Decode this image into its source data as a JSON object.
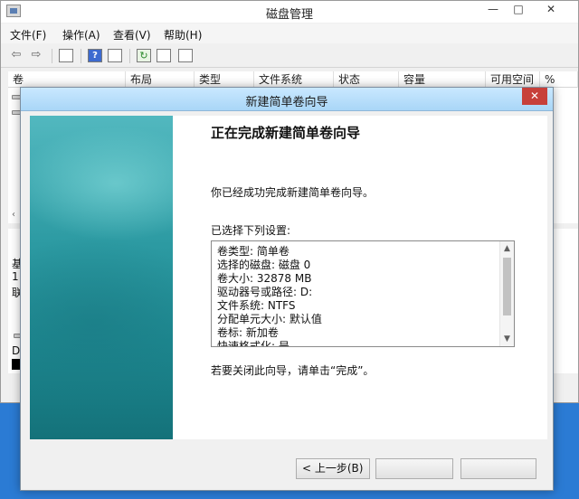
{
  "window": {
    "title": "磁盘管理",
    "min_glyph": "—",
    "max_glyph": "□",
    "close_glyph": "✕"
  },
  "menu": {
    "items": [
      "文件(F)",
      "操作(A)",
      "查看(V)",
      "帮助(H)"
    ]
  },
  "toolbar": {
    "back_glyph": "⇦",
    "forward_glyph": "⇨",
    "help_glyph": "?",
    "refresh_glyph": "↻"
  },
  "table": {
    "columns": [
      "卷",
      "布局",
      "类型",
      "文件系统",
      "状态",
      "容量",
      "可用空间",
      "%"
    ]
  },
  "lower": {
    "fragments": [
      "基",
      "1",
      "联",
      "D"
    ],
    "scroll_left_glyph": "‹"
  },
  "wizard": {
    "title": "新建简单卷向导",
    "close_glyph": "✕",
    "heading": "正在完成新建简单卷向导",
    "completed_text": "你已经成功完成新建简单卷向导。",
    "selected_label": "已选择下列设置:",
    "settings": [
      "卷类型: 简单卷",
      "选择的磁盘: 磁盘 0",
      "卷大小: 32878 MB",
      "驱动器号或路径: D:",
      "文件系统: NTFS",
      "分配单元大小: 默认值",
      "卷标: 新加卷",
      "快速格式化: 是"
    ],
    "scroll_up_glyph": "▲",
    "scroll_down_glyph": "▼",
    "close_instruction": "若要关闭此向导，请单击“完成”。",
    "buttons": {
      "back": "< 上一步(B)",
      "finish": "",
      "cancel": ""
    }
  },
  "colors": {
    "desktop": "#2b7bd4",
    "wizard_titlebar": "#b7def9",
    "close_button": "#c7403a",
    "banner_teal": "#2c9aa2"
  }
}
